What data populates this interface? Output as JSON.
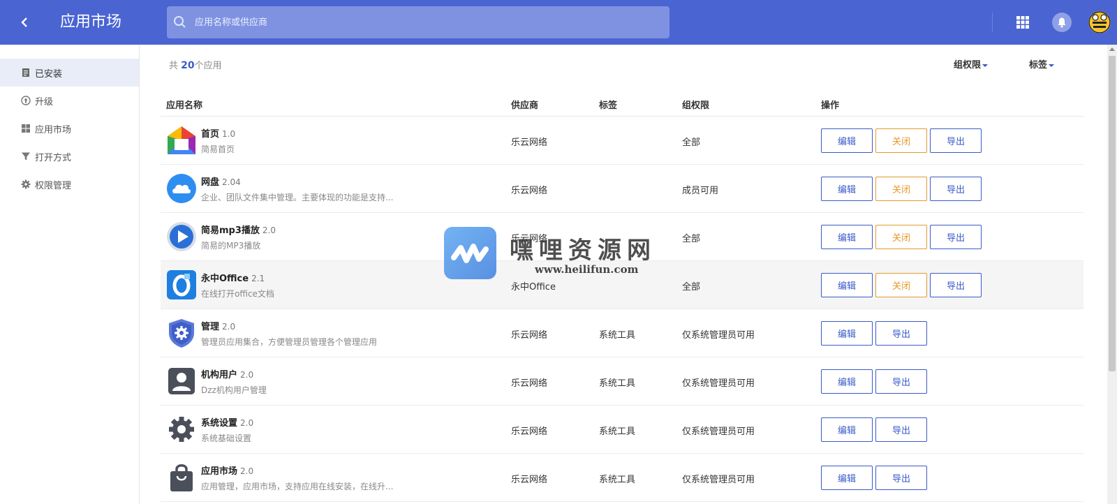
{
  "header": {
    "back_glyph": "‹",
    "title": "应用市场",
    "search_placeholder": "应用名称或供应商"
  },
  "sidebar": {
    "items": [
      {
        "label": "已安装",
        "icon": "document-icon",
        "active": true
      },
      {
        "label": "升级",
        "icon": "upgrade-icon",
        "active": false
      },
      {
        "label": "应用市场",
        "icon": "grid-icon",
        "active": false
      },
      {
        "label": "打开方式",
        "icon": "filter-icon",
        "active": false
      },
      {
        "label": "权限管理",
        "icon": "gear-icon",
        "active": false
      }
    ]
  },
  "main": {
    "count_prefix": "共",
    "count": "20",
    "count_suffix": "个应用",
    "filters": {
      "group_perm": "组权限",
      "tags": "标签"
    },
    "columns": {
      "name": "应用名称",
      "vendor": "供应商",
      "tag": "标签",
      "perm": "组权限",
      "ops": "操作"
    },
    "rows": [
      {
        "name": "首页",
        "version": "1.0",
        "desc": "简易首页",
        "vendor": "乐云网络",
        "tag": "",
        "perm": "全部",
        "icon": "home-icon",
        "buttons": [
          "编辑",
          "关闭",
          "导出"
        ]
      },
      {
        "name": "网盘",
        "version": "2.04",
        "desc": "企业、团队文件集中管理。主要体现的功能是支持...",
        "vendor": "乐云网络",
        "tag": "",
        "perm": "成员可用",
        "icon": "cloud-icon",
        "buttons": [
          "编辑",
          "关闭",
          "导出"
        ]
      },
      {
        "name": "简易mp3播放",
        "version": "2.0",
        "desc": "简易的MP3播放",
        "vendor": "乐云网络",
        "tag": "",
        "perm": "全部",
        "icon": "play-icon",
        "buttons": [
          "编辑",
          "关闭",
          "导出"
        ]
      },
      {
        "name": "永中Office",
        "version": "2.1",
        "desc": "在线打开office文档",
        "vendor": "永中Office",
        "tag": "",
        "perm": "全部",
        "icon": "office-icon",
        "buttons": [
          "编辑",
          "关闭",
          "导出"
        ]
      },
      {
        "name": "管理",
        "version": "2.0",
        "desc": "管理员应用集合，方便管理员管理各个管理应用",
        "vendor": "乐云网络",
        "tag": "系统工具",
        "perm": "仅系统管理员可用",
        "icon": "shield-gear-icon",
        "buttons": [
          "编辑",
          "导出"
        ]
      },
      {
        "name": "机构用户",
        "version": "2.0",
        "desc": "Dzz机构用户管理",
        "vendor": "乐云网络",
        "tag": "系统工具",
        "perm": "仅系统管理员可用",
        "icon": "user-icon",
        "buttons": [
          "编辑",
          "导出"
        ]
      },
      {
        "name": "系统设置",
        "version": "2.0",
        "desc": "系统基础设置",
        "vendor": "乐云网络",
        "tag": "系统工具",
        "perm": "仅系统管理员可用",
        "icon": "gear-icon",
        "buttons": [
          "编辑",
          "导出"
        ]
      },
      {
        "name": "应用市场",
        "version": "2.0",
        "desc": "应用管理，应用市场，支持应用在线安装，在线升...",
        "vendor": "乐云网络",
        "tag": "系统工具",
        "perm": "仅系统管理员可用",
        "icon": "bag-icon",
        "buttons": [
          "编辑",
          "导出"
        ]
      }
    ]
  },
  "watermark": {
    "text": "嘿哩资源网",
    "url": "www.heilifun.com"
  },
  "colors": {
    "header_bg": "#4a64d2",
    "accent": "#3a5ac8",
    "close_orange": "#e49a2b"
  }
}
